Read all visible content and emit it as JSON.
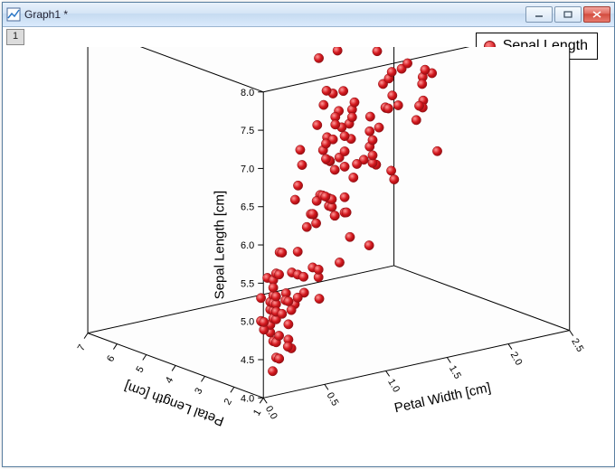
{
  "window": {
    "title": "Graph1 *",
    "tab_label": "1"
  },
  "legend": {
    "label": "Sepal Length"
  },
  "chart_data": {
    "type": "scatter",
    "dimensions": 3,
    "title": "",
    "xlabel": "Petal Length [cm]",
    "ylabel": "Petal Width [cm]",
    "zlabel": "Sepal Length [cm]",
    "xlim": [
      1,
      7
    ],
    "ylim": [
      0.0,
      2.5
    ],
    "zlim": [
      4.0,
      8.0
    ],
    "xticks": [
      1,
      2,
      3,
      4,
      5,
      6,
      7
    ],
    "yticks": [
      0.0,
      0.5,
      1.0,
      1.5,
      2.0,
      2.5
    ],
    "zticks": [
      4.0,
      4.5,
      5.0,
      5.5,
      6.0,
      6.5,
      7.0,
      7.5,
      8.0
    ],
    "series": [
      {
        "name": "Sepal Length",
        "color": "#d4181e",
        "points": [
          [
            1.4,
            0.2,
            5.1
          ],
          [
            1.4,
            0.2,
            4.9
          ],
          [
            1.3,
            0.2,
            4.7
          ],
          [
            1.5,
            0.2,
            4.6
          ],
          [
            1.4,
            0.2,
            5.0
          ],
          [
            1.7,
            0.4,
            5.4
          ],
          [
            1.4,
            0.3,
            4.6
          ],
          [
            1.5,
            0.2,
            5.0
          ],
          [
            1.4,
            0.2,
            4.4
          ],
          [
            1.5,
            0.1,
            4.9
          ],
          [
            1.5,
            0.2,
            5.4
          ],
          [
            1.6,
            0.2,
            4.8
          ],
          [
            1.4,
            0.1,
            4.8
          ],
          [
            1.1,
            0.1,
            4.3
          ],
          [
            1.2,
            0.2,
            5.8
          ],
          [
            1.5,
            0.4,
            5.7
          ],
          [
            1.3,
            0.4,
            5.4
          ],
          [
            1.4,
            0.3,
            5.1
          ],
          [
            1.7,
            0.3,
            5.7
          ],
          [
            1.5,
            0.3,
            5.1
          ],
          [
            1.7,
            0.2,
            5.4
          ],
          [
            1.5,
            0.4,
            5.1
          ],
          [
            1.0,
            0.2,
            4.6
          ],
          [
            1.7,
            0.5,
            5.1
          ],
          [
            1.9,
            0.2,
            4.8
          ],
          [
            1.6,
            0.2,
            5.0
          ],
          [
            1.6,
            0.4,
            5.0
          ],
          [
            1.5,
            0.2,
            5.2
          ],
          [
            1.4,
            0.2,
            5.2
          ],
          [
            1.6,
            0.2,
            4.7
          ],
          [
            1.6,
            0.2,
            4.8
          ],
          [
            1.5,
            0.4,
            5.4
          ],
          [
            1.5,
            0.1,
            5.2
          ],
          [
            1.4,
            0.2,
            5.5
          ],
          [
            1.5,
            0.2,
            4.9
          ],
          [
            1.2,
            0.2,
            5.0
          ],
          [
            1.3,
            0.2,
            5.5
          ],
          [
            1.4,
            0.1,
            4.9
          ],
          [
            1.3,
            0.2,
            4.4
          ],
          [
            1.5,
            0.2,
            5.1
          ],
          [
            1.3,
            0.3,
            5.0
          ],
          [
            1.3,
            0.3,
            4.5
          ],
          [
            1.3,
            0.2,
            4.4
          ],
          [
            1.6,
            0.6,
            5.0
          ],
          [
            1.9,
            0.4,
            5.1
          ],
          [
            1.4,
            0.3,
            4.8
          ],
          [
            1.6,
            0.2,
            5.1
          ],
          [
            1.4,
            0.2,
            4.6
          ],
          [
            1.5,
            0.2,
            5.3
          ],
          [
            1.4,
            0.2,
            5.0
          ],
          [
            4.7,
            1.4,
            7.0
          ],
          [
            4.5,
            1.5,
            6.4
          ],
          [
            4.9,
            1.5,
            6.9
          ],
          [
            4.0,
            1.3,
            5.5
          ],
          [
            4.6,
            1.5,
            6.5
          ],
          [
            4.5,
            1.3,
            5.7
          ],
          [
            4.7,
            1.6,
            6.3
          ],
          [
            3.3,
            1.0,
            4.9
          ],
          [
            4.6,
            1.3,
            6.6
          ],
          [
            3.9,
            1.4,
            5.2
          ],
          [
            3.5,
            1.0,
            5.0
          ],
          [
            4.2,
            1.5,
            5.9
          ],
          [
            4.0,
            1.0,
            6.0
          ],
          [
            4.7,
            1.4,
            6.1
          ],
          [
            3.6,
            1.3,
            5.6
          ],
          [
            4.4,
            1.4,
            6.7
          ],
          [
            4.5,
            1.5,
            5.6
          ],
          [
            4.1,
            1.0,
            5.8
          ],
          [
            4.5,
            1.5,
            6.2
          ],
          [
            3.9,
            1.1,
            5.6
          ],
          [
            4.8,
            1.8,
            5.9
          ],
          [
            4.0,
            1.3,
            6.1
          ],
          [
            4.9,
            1.5,
            6.3
          ],
          [
            4.7,
            1.2,
            6.1
          ],
          [
            4.3,
            1.3,
            6.4
          ],
          [
            4.4,
            1.4,
            6.6
          ],
          [
            4.8,
            1.4,
            6.8
          ],
          [
            5.0,
            1.7,
            6.7
          ],
          [
            4.5,
            1.5,
            6.0
          ],
          [
            3.5,
            1.0,
            5.7
          ],
          [
            3.8,
            1.1,
            5.5
          ],
          [
            3.7,
            1.0,
            5.5
          ],
          [
            3.9,
            1.2,
            5.8
          ],
          [
            5.1,
            1.6,
            6.0
          ],
          [
            4.5,
            1.5,
            5.4
          ],
          [
            4.5,
            1.6,
            6.0
          ],
          [
            4.7,
            1.5,
            6.7
          ],
          [
            4.4,
            1.3,
            6.3
          ],
          [
            4.1,
            1.3,
            5.6
          ],
          [
            4.0,
            1.3,
            5.5
          ],
          [
            4.4,
            1.2,
            5.5
          ],
          [
            4.6,
            1.4,
            6.1
          ],
          [
            4.0,
            1.2,
            5.8
          ],
          [
            3.3,
            1.0,
            5.0
          ],
          [
            4.2,
            1.3,
            5.6
          ],
          [
            4.2,
            1.2,
            5.7
          ],
          [
            4.2,
            1.3,
            5.7
          ],
          [
            4.3,
            1.3,
            6.2
          ],
          [
            3.0,
            1.1,
            5.1
          ],
          [
            4.1,
            1.3,
            5.7
          ],
          [
            6.0,
            2.5,
            6.3
          ],
          [
            5.1,
            1.9,
            5.8
          ],
          [
            5.9,
            2.1,
            7.1
          ],
          [
            5.6,
            1.8,
            6.3
          ],
          [
            5.8,
            2.2,
            6.5
          ],
          [
            6.6,
            2.1,
            7.6
          ],
          [
            4.5,
            1.7,
            4.9
          ],
          [
            6.3,
            1.8,
            7.3
          ],
          [
            5.8,
            1.8,
            6.7
          ],
          [
            6.1,
            2.5,
            7.2
          ],
          [
            5.1,
            2.0,
            6.5
          ],
          [
            5.3,
            1.9,
            6.4
          ],
          [
            5.5,
            2.1,
            6.8
          ],
          [
            5.0,
            2.0,
            5.7
          ],
          [
            5.1,
            2.4,
            5.8
          ],
          [
            5.3,
            2.3,
            6.4
          ],
          [
            5.5,
            1.8,
            6.5
          ],
          [
            6.7,
            2.2,
            7.7
          ],
          [
            6.9,
            2.3,
            7.7
          ],
          [
            5.0,
            1.5,
            6.0
          ],
          [
            5.7,
            2.3,
            6.9
          ],
          [
            4.9,
            2.0,
            5.6
          ],
          [
            6.7,
            2.0,
            7.7
          ],
          [
            4.9,
            1.8,
            6.3
          ],
          [
            5.7,
            2.1,
            6.7
          ],
          [
            6.0,
            1.8,
            7.2
          ],
          [
            4.8,
            1.8,
            6.2
          ],
          [
            4.9,
            1.8,
            6.1
          ],
          [
            5.6,
            2.1,
            6.4
          ],
          [
            5.8,
            1.6,
            7.2
          ],
          [
            6.1,
            1.9,
            7.4
          ],
          [
            6.4,
            2.0,
            7.9
          ],
          [
            5.6,
            2.2,
            6.4
          ],
          [
            5.1,
            1.5,
            6.3
          ],
          [
            5.6,
            1.4,
            6.1
          ],
          [
            6.1,
            2.3,
            7.7
          ],
          [
            5.6,
            2.4,
            6.3
          ],
          [
            5.5,
            1.8,
            6.4
          ],
          [
            4.8,
            1.8,
            6.0
          ],
          [
            5.4,
            2.1,
            6.9
          ],
          [
            5.6,
            2.4,
            6.7
          ],
          [
            5.1,
            2.3,
            6.9
          ],
          [
            5.1,
            1.9,
            5.8
          ],
          [
            5.9,
            2.3,
            6.8
          ],
          [
            5.7,
            2.5,
            6.7
          ],
          [
            5.2,
            2.3,
            6.7
          ],
          [
            5.0,
            1.9,
            6.3
          ],
          [
            5.2,
            2.0,
            6.5
          ],
          [
            5.4,
            2.3,
            6.2
          ],
          [
            5.1,
            1.8,
            5.9
          ]
        ]
      }
    ]
  }
}
